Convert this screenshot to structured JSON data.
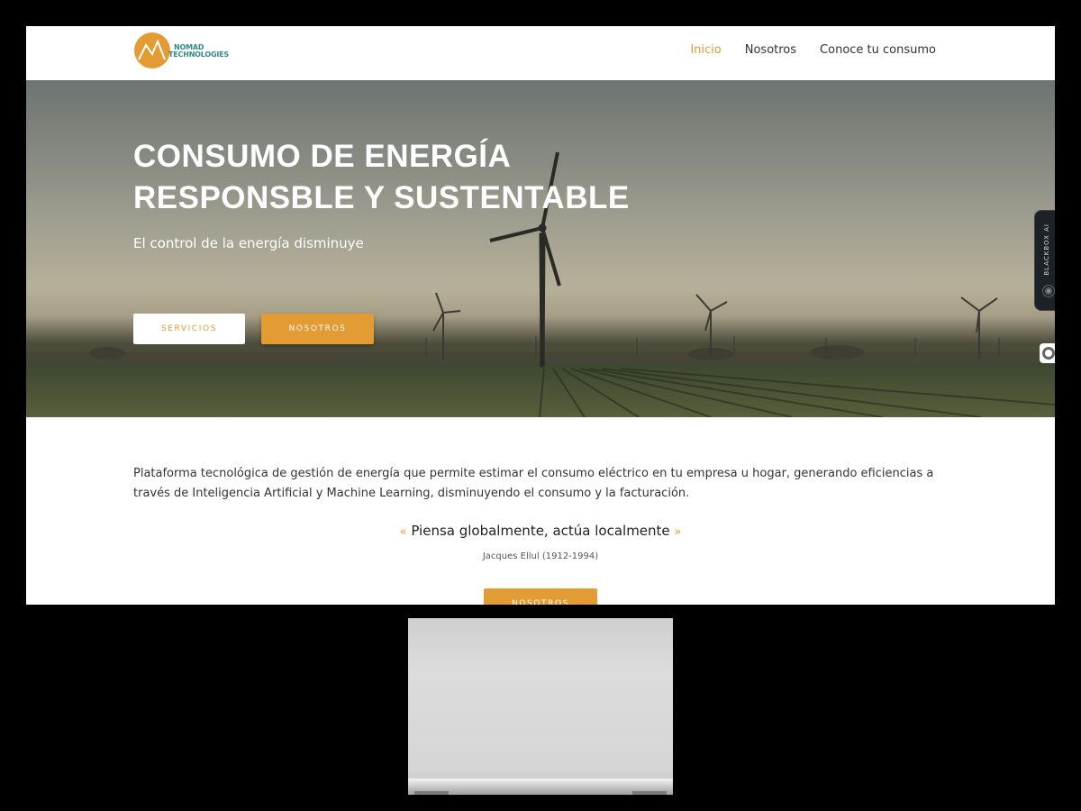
{
  "logo": {
    "line1": "NOMAD",
    "line2": "TECHNOLOGIES"
  },
  "nav": {
    "items": [
      "Inicio",
      "Nosotros",
      "Conoce tu consumo"
    ],
    "active": "Inicio"
  },
  "hero": {
    "title_line1": "CONSUMO DE ENERGÍA",
    "title_line2": "RESPONSBLE Y SUSTENTABLE",
    "subtitle": "El control de la energía disminuye",
    "button_servicios": "SERVICIOS",
    "button_nosotros": "NOSOTROS"
  },
  "side_widget": {
    "label": "BLACKBOX AI"
  },
  "content": {
    "intro": " Plataforma tecnológica de gestión de energía que permite estimar el consumo eléctrico en tu empresa u hogar, generando eficiencias a través de Inteligencia Artificial y Machine Learning, disminuyendo el consumo y la facturación.",
    "quote_open": "«",
    "quote": "Piensa globalmente, actúa localmente",
    "quote_close": "»",
    "author": "Jacques Ellul (1912-1994)",
    "button_nosotros": "NOSOTROS"
  },
  "colors": {
    "accent": "#e39b34",
    "logo_text": "#2f8a8a",
    "text": "#333333",
    "frame": "#000000"
  },
  "icons": {
    "logo": "mountain-logo-icon",
    "side_widget": "blackbox-ai-icon",
    "side_circle": "circle-icon"
  }
}
